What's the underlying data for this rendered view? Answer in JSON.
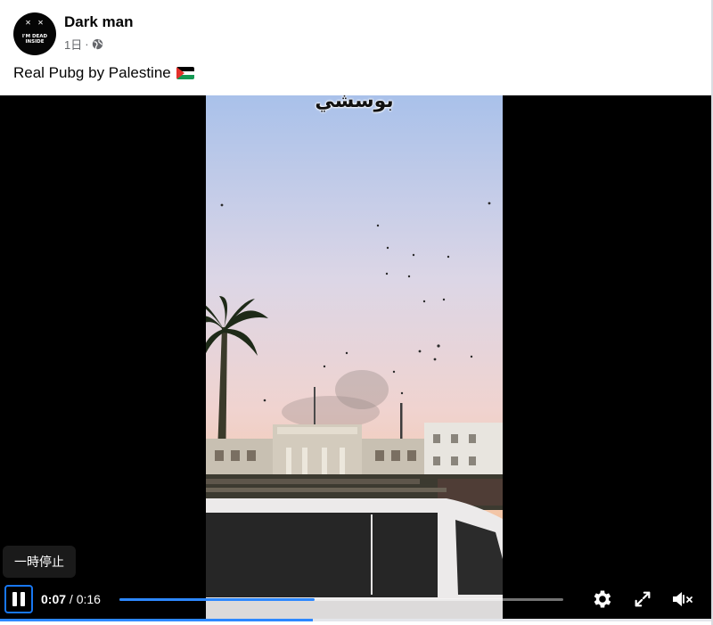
{
  "post": {
    "author": "Dark man",
    "time": "1日",
    "separator": "·",
    "privacy_icon": "globe-icon",
    "caption": "Real Pubg by Palestine",
    "caption_emoji": "palestine-flag-icon",
    "avatar": {
      "face": "✕ ✕",
      "line1": "I'M DEAD",
      "line2": "INSIDE"
    }
  },
  "video": {
    "overlay_text": "بوسشي",
    "tooltip": "一時停止",
    "current_time": "0:07",
    "time_separator": "/",
    "duration": "0:16",
    "progress": 0.44,
    "colors": {
      "accent": "#2d88ff",
      "focus_ring": "#1877f2"
    },
    "controls": {
      "play_pause": "pause-icon",
      "settings": "gear-icon",
      "fullscreen": "fullscreen-icon",
      "volume": "volume-muted-icon"
    }
  }
}
